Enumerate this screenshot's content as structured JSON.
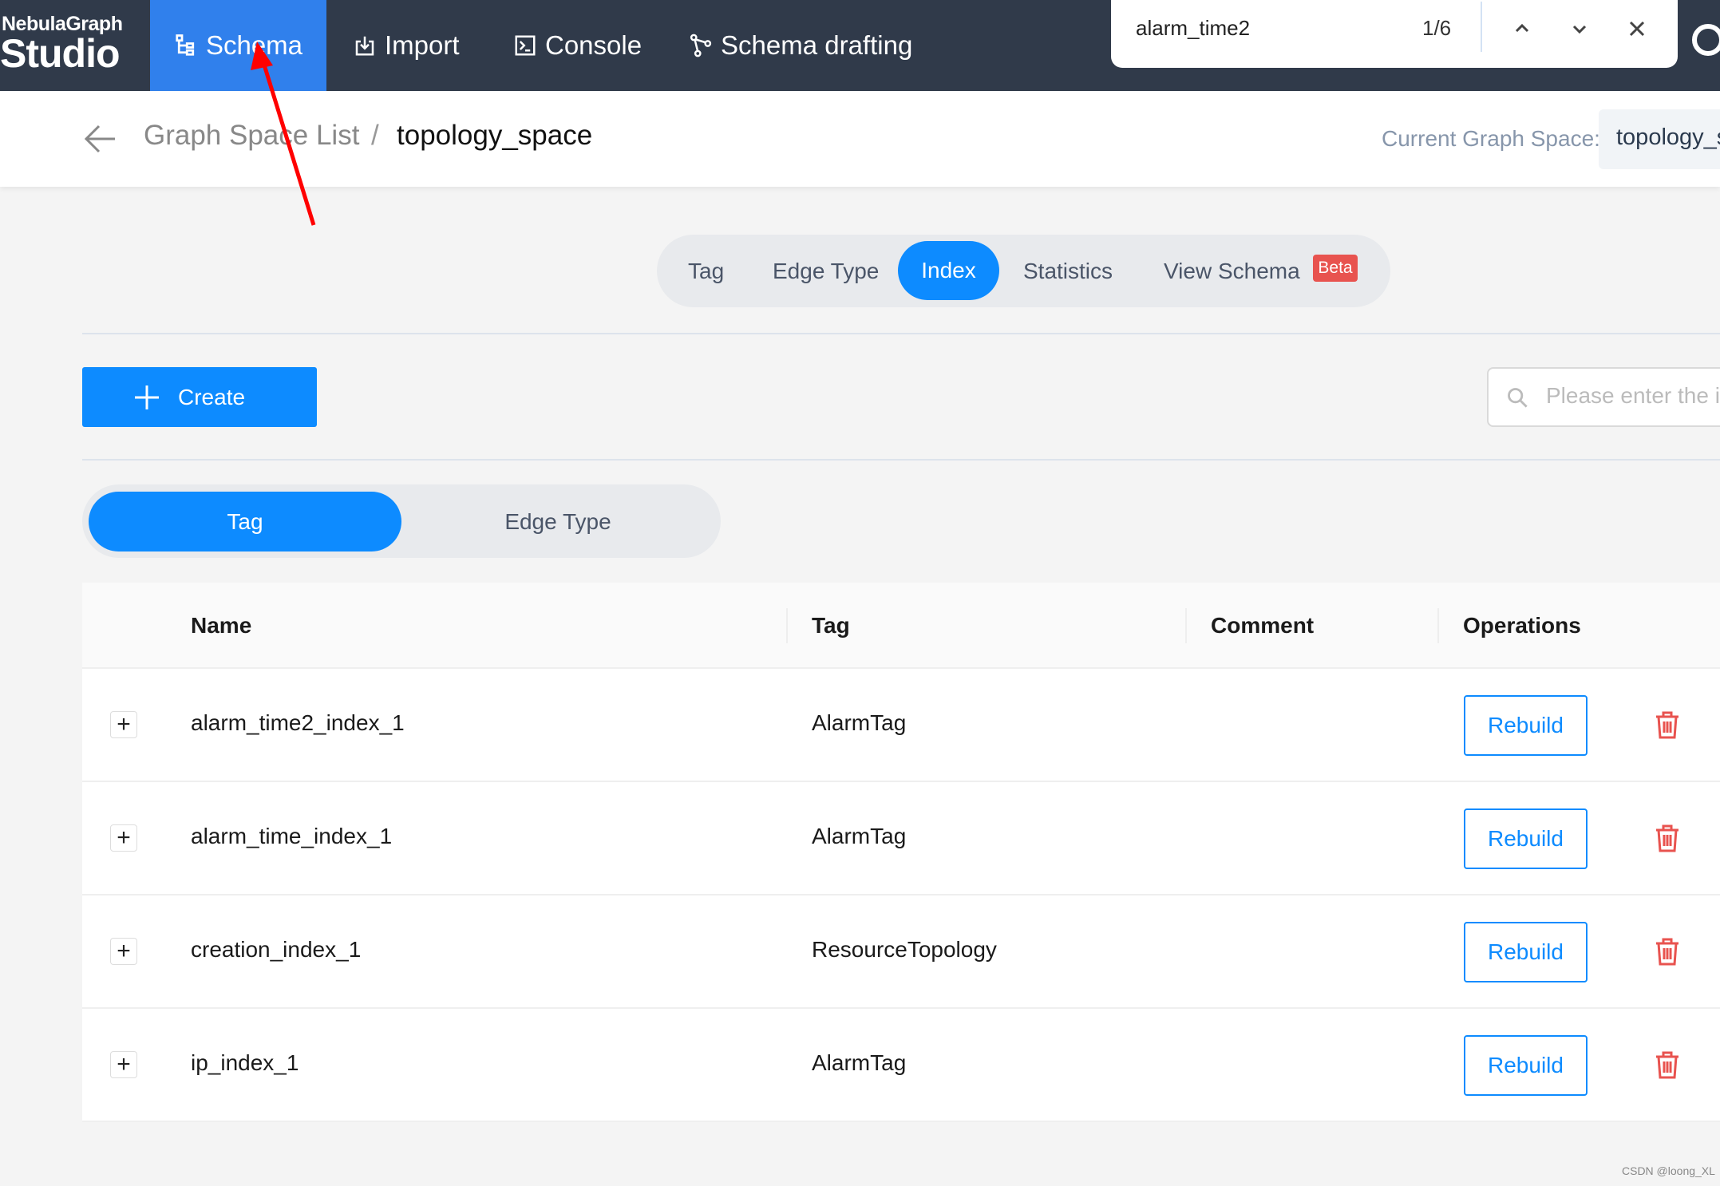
{
  "nav": {
    "logo_top": "NebulaGraph",
    "logo_bottom": "Studio",
    "items": [
      {
        "label": "Schema",
        "icon": "schema-tree-icon",
        "active": true
      },
      {
        "label": "Import",
        "icon": "import-icon"
      },
      {
        "label": "Console",
        "icon": "console-icon"
      },
      {
        "label": "Schema drafting",
        "icon": "drafting-icon"
      }
    ]
  },
  "find_bar": {
    "query": "alarm_time2",
    "count": "1/6"
  },
  "breadcrumb": {
    "parent": "Graph Space List",
    "separator": "/",
    "current": "topology_space",
    "current_label": "Current Graph Space:",
    "current_value": "topology_space"
  },
  "tabs": [
    {
      "label": "Tag"
    },
    {
      "label": "Edge Type"
    },
    {
      "label": "Index",
      "active": true
    },
    {
      "label": "Statistics"
    },
    {
      "label": "View Schema",
      "badge": "Beta"
    }
  ],
  "create_label": "Create",
  "search_placeholder": "Please enter the index name",
  "segment": [
    {
      "label": "Tag",
      "active": true
    },
    {
      "label": "Edge Type"
    }
  ],
  "table": {
    "headers": [
      "Name",
      "Tag",
      "Comment",
      "Operations"
    ],
    "rows": [
      {
        "name": "alarm_time2_index_1",
        "tag": "AlarmTag",
        "comment": ""
      },
      {
        "name": "alarm_time_index_1",
        "tag": "AlarmTag",
        "comment": ""
      },
      {
        "name": "creation_index_1",
        "tag": "ResourceTopology",
        "comment": ""
      },
      {
        "name": "ip_index_1",
        "tag": "AlarmTag",
        "comment": ""
      }
    ],
    "rebuild_label": "Rebuild"
  },
  "colors": {
    "nav_bg": "#303a4a",
    "accent": "#0d8bff",
    "active_nav": "#3080ec",
    "danger": "#e8534f",
    "annotation_arrow": "#ff0000"
  },
  "watermark": "CSDN @loong_XL"
}
